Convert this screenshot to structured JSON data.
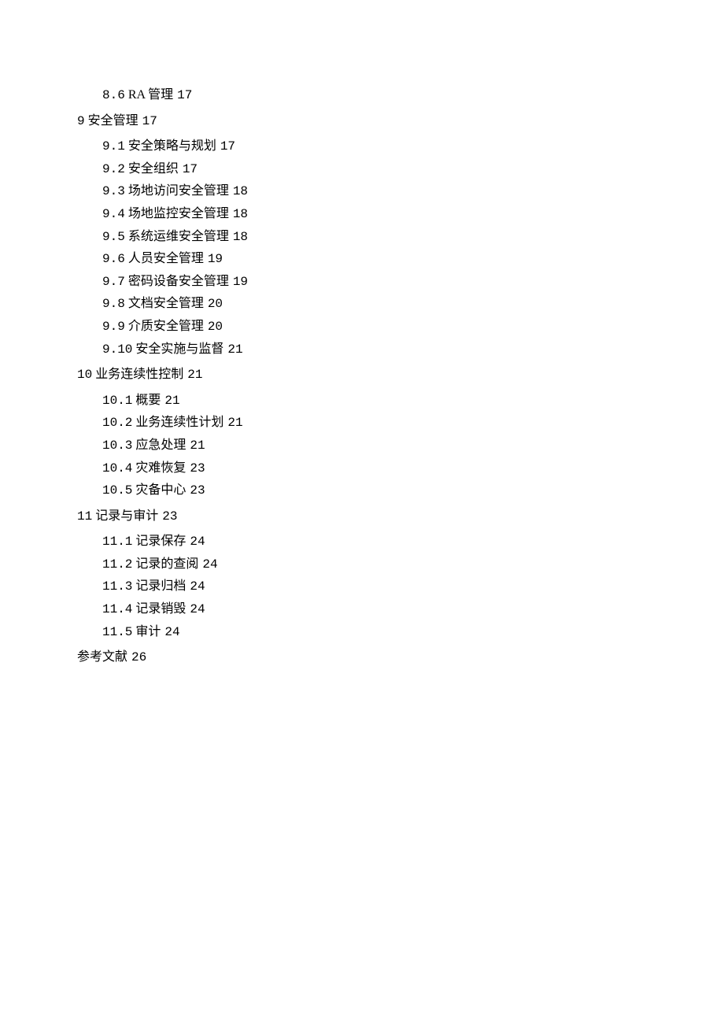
{
  "toc": [
    {
      "level": "sub",
      "num": "8.6",
      "title": "RA 管理",
      "page": "17"
    },
    {
      "level": "section",
      "num": "9",
      "title": "安全管理",
      "page": "17"
    },
    {
      "level": "sub",
      "num": "9.1",
      "title": "安全策略与规划",
      "page": "17"
    },
    {
      "level": "sub",
      "num": "9.2",
      "title": "安全组织",
      "page": "17"
    },
    {
      "level": "sub",
      "num": "9.3",
      "title": "场地访问安全管理",
      "page": "18"
    },
    {
      "level": "sub",
      "num": "9.4",
      "title": "场地监控安全管理",
      "page": "18"
    },
    {
      "level": "sub",
      "num": "9.5",
      "title": "系统运维安全管理",
      "page": "18"
    },
    {
      "level": "sub",
      "num": "9.6",
      "title": "人员安全管理",
      "page": "19"
    },
    {
      "level": "sub",
      "num": "9.7",
      "title": "密码设备安全管理",
      "page": "19"
    },
    {
      "level": "sub",
      "num": "9.8",
      "title": "文档安全管理",
      "page": "20"
    },
    {
      "level": "sub",
      "num": "9.9",
      "title": "介质安全管理",
      "page": "20"
    },
    {
      "level": "sub",
      "num": "9.10",
      "title": "安全实施与监督",
      "page": "21"
    },
    {
      "level": "section",
      "num": "10",
      "title": "业务连续性控制",
      "page": "21"
    },
    {
      "level": "sub",
      "num": "10.1",
      "title": "概要",
      "page": "21"
    },
    {
      "level": "sub",
      "num": "10.2",
      "title": "业务连续性计划",
      "page": "21"
    },
    {
      "level": "sub",
      "num": "10.3",
      "title": "应急处理",
      "page": "21"
    },
    {
      "level": "sub",
      "num": "10.4",
      "title": "灾难恢复",
      "page": "23"
    },
    {
      "level": "sub",
      "num": "10.5",
      "title": "灾备中心",
      "page": "23"
    },
    {
      "level": "section",
      "num": "11",
      "title": "记录与审计",
      "page": "23"
    },
    {
      "level": "sub",
      "num": "11.1",
      "title": "记录保存",
      "page": "24"
    },
    {
      "level": "sub",
      "num": "11.2",
      "title": "记录的查阅",
      "page": "24"
    },
    {
      "level": "sub",
      "num": "11.3",
      "title": "记录归档",
      "page": "24"
    },
    {
      "level": "sub",
      "num": "11.4",
      "title": "记录销毁",
      "page": "24"
    },
    {
      "level": "sub",
      "num": "11.5",
      "title": "审计",
      "page": "24"
    },
    {
      "level": "ref",
      "num": "",
      "title": "参考文献",
      "page": "26"
    }
  ]
}
